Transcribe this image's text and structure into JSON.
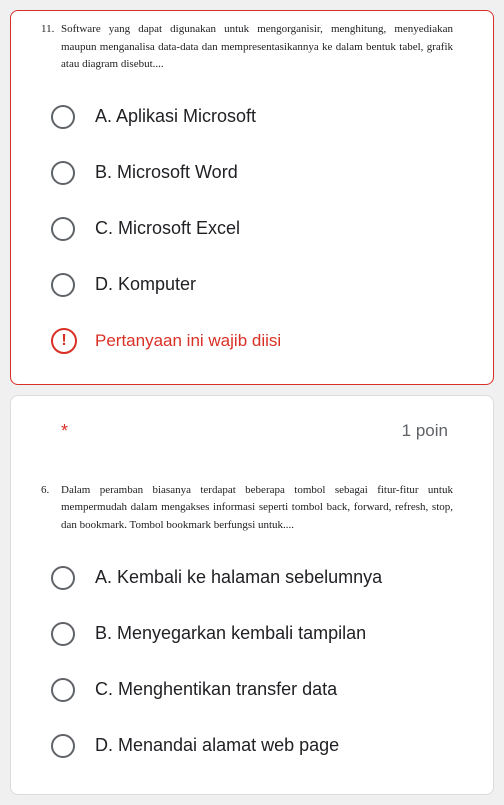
{
  "question11": {
    "number": "11.",
    "text": "Software yang dapat digunakan untuk mengorganisir, menghitung, menyediakan maupun menganalisa data-data dan mempresentasikannya ke dalam bentuk tabel, grafik atau diagram disebut....",
    "options": {
      "a": "A. Aplikasi Microsoft",
      "b": "B. Microsoft Word",
      "c": "C. Microsoft Excel",
      "d": "D. Komputer"
    },
    "error": "Pertanyaan ini wajib diisi"
  },
  "question6": {
    "required": "*",
    "points": "1 poin",
    "number": "6.",
    "text": "Dalam peramban biasanya terdapat beberapa tombol sebagai fitur-fitur untuk mempermudah dalam mengakses informasi seperti tombol back, forward, refresh, stop, dan bookmark. Tombol bookmark berfungsi untuk....",
    "options": {
      "a": "A. Kembali ke halaman sebelumnya",
      "b": "B. Menyegarkan kembali tampilan",
      "c": "C. Menghentikan transfer data",
      "d": "D. Menandai alamat web page"
    }
  }
}
